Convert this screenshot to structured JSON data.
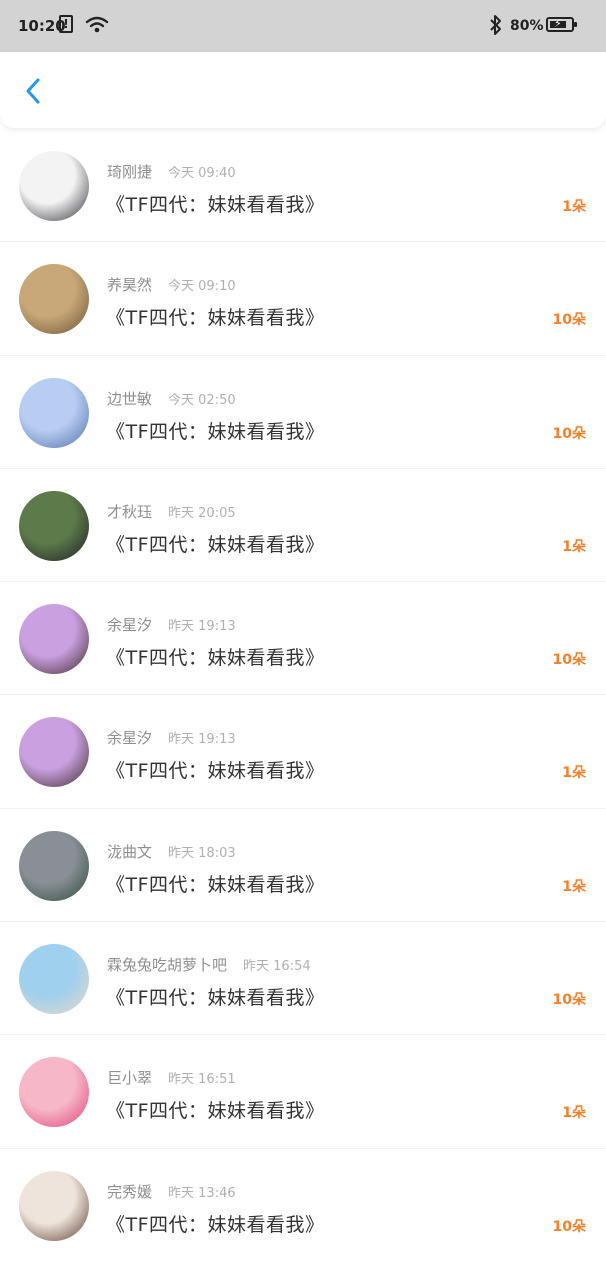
{
  "status_bar": {
    "time": "10:20",
    "alert_glyph": "!",
    "battery_percent": "80%",
    "battery_level": 0.8
  },
  "nav": {
    "back_icon": "chevron-left-icon",
    "accent_color": "#2196f3"
  },
  "accent_count_color": "#f5802a",
  "items": [
    {
      "name": "琦刚捷",
      "time": "今天 09:40",
      "title": "《TF四代：妹妹看看我》",
      "count": "1朵",
      "avatar_colors": [
        "#f3f3f3",
        "#2d2d35"
      ]
    },
    {
      "name": "养昊然",
      "time": "今天 09:10",
      "title": "《TF四代：妹妹看看我》",
      "count": "10朵",
      "avatar_colors": [
        "#c8a878",
        "#6b5235"
      ]
    },
    {
      "name": "边世敏",
      "time": "今天 02:50",
      "title": "《TF四代：妹妹看看我》",
      "count": "10朵",
      "avatar_colors": [
        "#b8cdf2",
        "#4f6fa8"
      ]
    },
    {
      "name": "才秋珏",
      "time": "昨天 20:05",
      "title": "《TF四代：妹妹看看我》",
      "count": "1朵",
      "avatar_colors": [
        "#5d7a4a",
        "#1c1c26"
      ]
    },
    {
      "name": "余星汐",
      "time": "昨天 19:13",
      "title": "《TF四代：妹妹看看我》",
      "count": "10朵",
      "avatar_colors": [
        "#caa0e0",
        "#3a2a2a"
      ]
    },
    {
      "name": "余星汐",
      "time": "昨天 19:13",
      "title": "《TF四代：妹妹看看我》",
      "count": "1朵",
      "avatar_colors": [
        "#caa0e0",
        "#3a2a2a"
      ]
    },
    {
      "name": "泷曲文",
      "time": "昨天 18:03",
      "title": "《TF四代：妹妹看看我》",
      "count": "1朵",
      "avatar_colors": [
        "#8a8f95",
        "#2c4a3a"
      ]
    },
    {
      "name": "霖兔兔吃胡萝卜吧",
      "time": "昨天 16:54",
      "title": "《TF四代：妹妹看看我》",
      "count": "10朵",
      "avatar_colors": [
        "#9fd0ee",
        "#e9d8c8"
      ]
    },
    {
      "name": "巨小翠",
      "time": "昨天 16:51",
      "title": "《TF四代：妹妹看看我》",
      "count": "1朵",
      "avatar_colors": [
        "#f6b8c8",
        "#e0407a"
      ]
    },
    {
      "name": "完秀媛",
      "time": "昨天 13:46",
      "title": "《TF四代：妹妹看看我》",
      "count": "10朵",
      "avatar_colors": [
        "#efe4dc",
        "#5a3a2a"
      ]
    }
  ]
}
